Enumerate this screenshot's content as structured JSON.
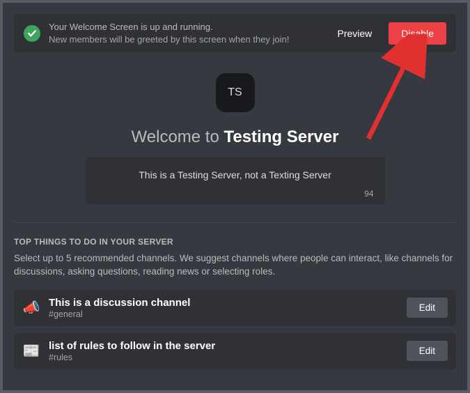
{
  "notice": {
    "line1": "Your Welcome Screen is up and running.",
    "line2": "New members will be greeted by this screen when they join!",
    "preview_label": "Preview",
    "disable_label": "Disable"
  },
  "hero": {
    "server_initials": "TS",
    "welcome_prefix": "Welcome to ",
    "server_name": "Testing Server",
    "description": "This is a Testing Server, not a Texting Server",
    "char_count": "94"
  },
  "section": {
    "title": "TOP THINGS TO DO IN YOUR SERVER",
    "description": "Select up to 5 recommended channels. We suggest channels where people can interact, like channels for discussions, asking questions, reading news or selecting roles."
  },
  "channels": [
    {
      "icon": "📣",
      "title": "This is a discussion channel",
      "sub": "#general",
      "edit": "Edit"
    },
    {
      "icon": "📰",
      "title": "list of rules to follow in the server",
      "sub": "#rules",
      "edit": "Edit"
    }
  ]
}
